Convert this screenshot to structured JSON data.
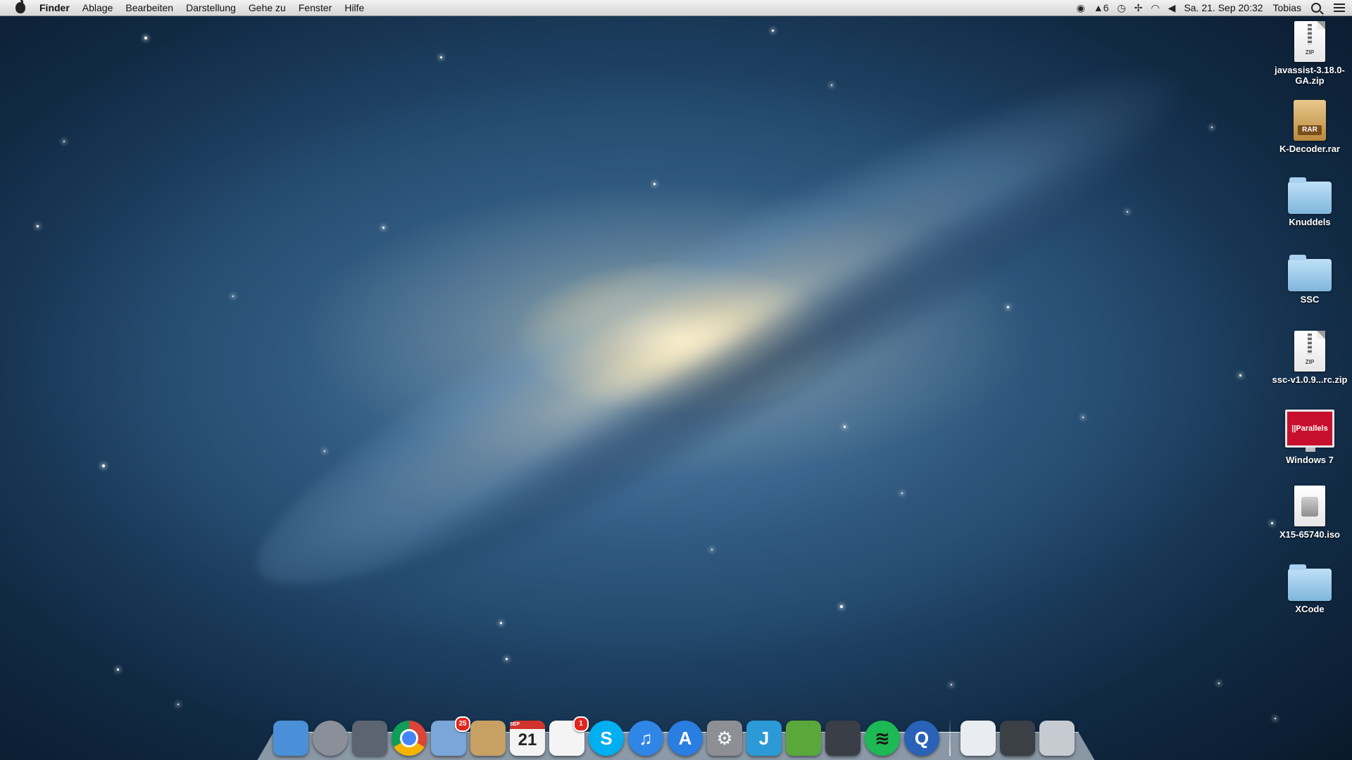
{
  "menubar": {
    "app_name": "Finder",
    "items": [
      "Ablage",
      "Bearbeiten",
      "Darstellung",
      "Gehe zu",
      "Fenster",
      "Hilfe"
    ],
    "status": {
      "notification_count": "6",
      "datetime": "Sa. 21. Sep  20:32",
      "user": "Tobias"
    }
  },
  "desktop_icons": [
    {
      "label": "javassist-3.18.0-GA.zip",
      "kind": "zip"
    },
    {
      "label": "K-Decoder.rar",
      "kind": "rar",
      "badge": "RAR"
    },
    {
      "label": "Knuddels",
      "kind": "folder"
    },
    {
      "label": "SSC",
      "kind": "folder"
    },
    {
      "label": "ssc-v1.0.9...rc.zip",
      "kind": "zip"
    },
    {
      "label": "Windows 7",
      "kind": "parallels",
      "badge": "||Parallels"
    },
    {
      "label": "X15-65740.iso",
      "kind": "iso"
    },
    {
      "label": "XCode",
      "kind": "folder"
    }
  ],
  "zip_badge": "ZIP",
  "dock": {
    "apps": [
      {
        "name": "finder-icon",
        "color": "#4a8fd8"
      },
      {
        "name": "launchpad-icon",
        "color": "#8a8f99"
      },
      {
        "name": "image-capture-icon",
        "color": "#5b6470"
      },
      {
        "name": "chrome-icon",
        "color": "#3b7be0"
      },
      {
        "name": "mail-icon",
        "color": "#7aa7d8",
        "badge": "25"
      },
      {
        "name": "contacts-icon",
        "color": "#c8a064"
      },
      {
        "name": "calendar-icon",
        "color": "#f3f3f3",
        "day": "21",
        "month": "SEP"
      },
      {
        "name": "reminders-icon",
        "color": "#f4f4f4",
        "badge": "1"
      },
      {
        "name": "skype-icon",
        "color": "#00aff0",
        "glyph": "S"
      },
      {
        "name": "itunes-icon",
        "color": "#2f86e6",
        "glyph": "♫"
      },
      {
        "name": "app-store-icon",
        "color": "#2a7de1",
        "glyph": "A"
      },
      {
        "name": "system-preferences-icon",
        "color": "#8d8f94",
        "glyph": "⚙"
      },
      {
        "name": "intellij-icon",
        "color": "#2b9ad6",
        "glyph": "J"
      },
      {
        "name": "leaf-app-icon",
        "color": "#5aa83a"
      },
      {
        "name": "steam-icon",
        "color": "#3a3f47"
      },
      {
        "name": "spotify-icon",
        "color": "#1db954"
      },
      {
        "name": "quicktime-icon",
        "color": "#2a62b8",
        "glyph": "Q"
      }
    ],
    "right": [
      {
        "name": "documents-stack-icon",
        "color": "#e9edf2"
      },
      {
        "name": "downloads-stack-icon",
        "color": "#3b3f46"
      },
      {
        "name": "trash-icon",
        "color": "#c6cbd1"
      }
    ]
  }
}
